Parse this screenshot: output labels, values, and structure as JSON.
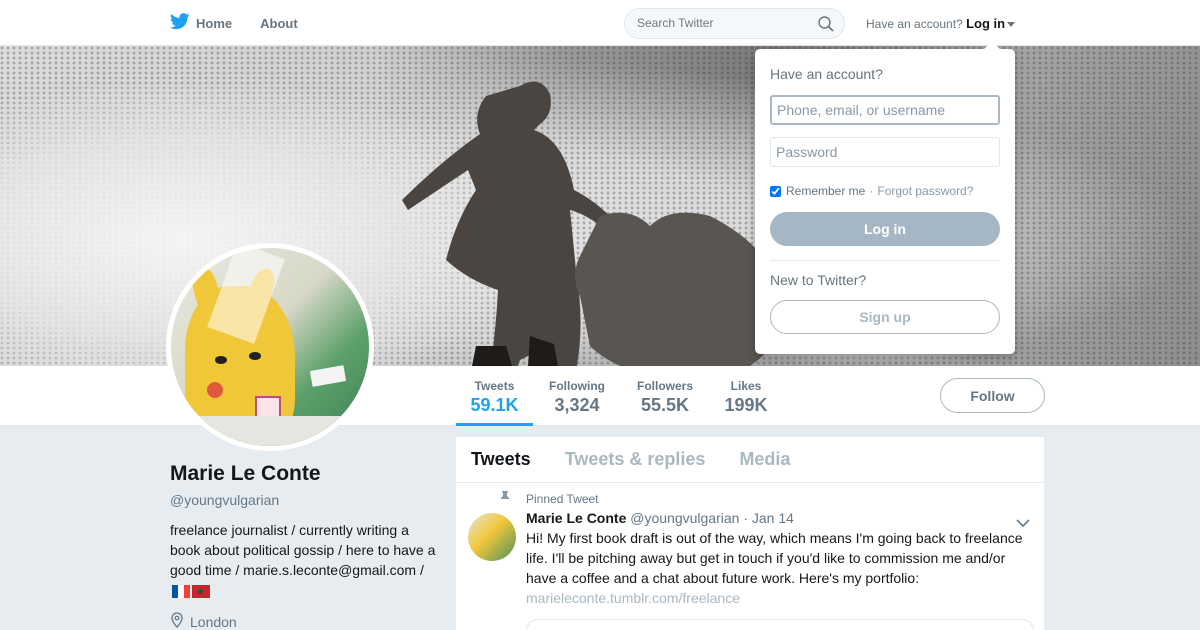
{
  "nav": {
    "home_label": "Home",
    "about_label": "About",
    "search_placeholder": "Search Twitter",
    "have_account": "Have an account?",
    "login_label": "Log in",
    "icons": {
      "logo": "twitter-bird-icon",
      "search": "search-icon"
    },
    "accent_color": "#1da1f2"
  },
  "profile_stats": [
    {
      "label": "Tweets",
      "value": "59.1K"
    },
    {
      "label": "Following",
      "value": "3,324"
    },
    {
      "label": "Followers",
      "value": "55.5K"
    },
    {
      "label": "Likes",
      "value": "199K"
    }
  ],
  "follow_label": "Follow",
  "profile": {
    "name": "Marie Le Conte",
    "handle": "@youngvulgarian",
    "bio": "freelance journalist / currently writing a book about political gossip / here to have a good time / marie.s.leconte@gmail.com /",
    "location": "London"
  },
  "timeline": {
    "tabs": [
      "Tweets",
      "Tweets & replies",
      "Media"
    ],
    "pinned_label": "Pinned Tweet",
    "tweet": {
      "name": "Marie Le Conte",
      "handle": "@youngvulgarian",
      "date": "· Jan 14",
      "text": "Hi! My first book draft is out of the way, which means I'm going back to freelance life. I'll be pitching away but get in touch if you'd like to commission me and/or have a coffee and a chat about future work. Here's my portfolio:",
      "link": "marieleconte.tumblr.com/freelance"
    }
  },
  "login_dropdown": {
    "title": "Have an account?",
    "username_placeholder": "Phone, email, or username",
    "password_placeholder": "Password",
    "remember_label": "Remember me",
    "separator": "·",
    "forgot_label": "Forgot password?",
    "login_button": "Log in",
    "new_label": "New to Twitter?",
    "signup_button": "Sign up"
  }
}
